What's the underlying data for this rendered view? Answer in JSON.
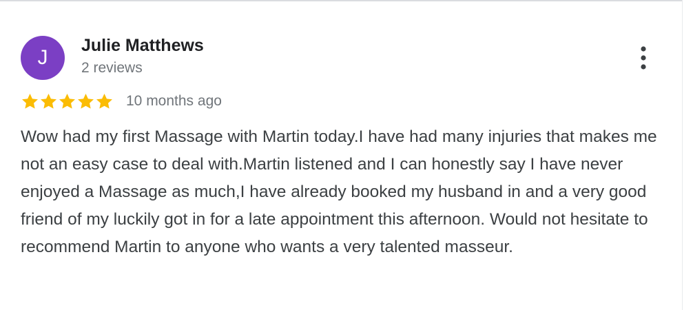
{
  "review": {
    "reviewer_initial": "J",
    "reviewer_name": "Julie Matthews",
    "review_count": "2 reviews",
    "rating": 5,
    "rating_max": 5,
    "date": "10 months ago",
    "text": "Wow had my first Massage with Martin today.I have had many injuries that makes me not an easy case to deal with.Martin listened and I can honestly say I have never enjoyed a Massage as much,I have already booked my husband in and a very good friend of my luckily got in for a late appointment this afternoon. Would not hesitate to recommend Martin to anyone who wants a very talented masseur."
  },
  "colors": {
    "avatar_bg": "#7b3fc4",
    "star": "#fbbc04",
    "name": "#202124",
    "meta": "#70757a",
    "body_text": "#3c4043"
  },
  "icons": {
    "more": "more-vertical-icon",
    "star": "star-icon"
  }
}
